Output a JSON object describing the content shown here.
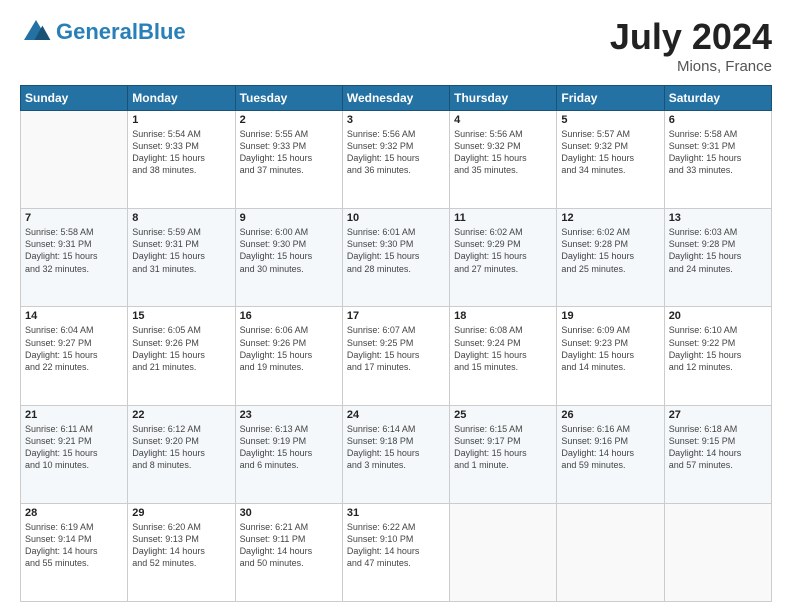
{
  "header": {
    "logo": {
      "text_general": "General",
      "text_blue": "Blue"
    },
    "title": "July 2024",
    "location": "Mions, France"
  },
  "days_of_week": [
    "Sunday",
    "Monday",
    "Tuesday",
    "Wednesday",
    "Thursday",
    "Friday",
    "Saturday"
  ],
  "weeks": [
    [
      {
        "day": "",
        "info": ""
      },
      {
        "day": "1",
        "info": "Sunrise: 5:54 AM\nSunset: 9:33 PM\nDaylight: 15 hours\nand 38 minutes."
      },
      {
        "day": "2",
        "info": "Sunrise: 5:55 AM\nSunset: 9:33 PM\nDaylight: 15 hours\nand 37 minutes."
      },
      {
        "day": "3",
        "info": "Sunrise: 5:56 AM\nSunset: 9:32 PM\nDaylight: 15 hours\nand 36 minutes."
      },
      {
        "day": "4",
        "info": "Sunrise: 5:56 AM\nSunset: 9:32 PM\nDaylight: 15 hours\nand 35 minutes."
      },
      {
        "day": "5",
        "info": "Sunrise: 5:57 AM\nSunset: 9:32 PM\nDaylight: 15 hours\nand 34 minutes."
      },
      {
        "day": "6",
        "info": "Sunrise: 5:58 AM\nSunset: 9:31 PM\nDaylight: 15 hours\nand 33 minutes."
      }
    ],
    [
      {
        "day": "7",
        "info": "Sunrise: 5:58 AM\nSunset: 9:31 PM\nDaylight: 15 hours\nand 32 minutes."
      },
      {
        "day": "8",
        "info": "Sunrise: 5:59 AM\nSunset: 9:31 PM\nDaylight: 15 hours\nand 31 minutes."
      },
      {
        "day": "9",
        "info": "Sunrise: 6:00 AM\nSunset: 9:30 PM\nDaylight: 15 hours\nand 30 minutes."
      },
      {
        "day": "10",
        "info": "Sunrise: 6:01 AM\nSunset: 9:30 PM\nDaylight: 15 hours\nand 28 minutes."
      },
      {
        "day": "11",
        "info": "Sunrise: 6:02 AM\nSunset: 9:29 PM\nDaylight: 15 hours\nand 27 minutes."
      },
      {
        "day": "12",
        "info": "Sunrise: 6:02 AM\nSunset: 9:28 PM\nDaylight: 15 hours\nand 25 minutes."
      },
      {
        "day": "13",
        "info": "Sunrise: 6:03 AM\nSunset: 9:28 PM\nDaylight: 15 hours\nand 24 minutes."
      }
    ],
    [
      {
        "day": "14",
        "info": "Sunrise: 6:04 AM\nSunset: 9:27 PM\nDaylight: 15 hours\nand 22 minutes."
      },
      {
        "day": "15",
        "info": "Sunrise: 6:05 AM\nSunset: 9:26 PM\nDaylight: 15 hours\nand 21 minutes."
      },
      {
        "day": "16",
        "info": "Sunrise: 6:06 AM\nSunset: 9:26 PM\nDaylight: 15 hours\nand 19 minutes."
      },
      {
        "day": "17",
        "info": "Sunrise: 6:07 AM\nSunset: 9:25 PM\nDaylight: 15 hours\nand 17 minutes."
      },
      {
        "day": "18",
        "info": "Sunrise: 6:08 AM\nSunset: 9:24 PM\nDaylight: 15 hours\nand 15 minutes."
      },
      {
        "day": "19",
        "info": "Sunrise: 6:09 AM\nSunset: 9:23 PM\nDaylight: 15 hours\nand 14 minutes."
      },
      {
        "day": "20",
        "info": "Sunrise: 6:10 AM\nSunset: 9:22 PM\nDaylight: 15 hours\nand 12 minutes."
      }
    ],
    [
      {
        "day": "21",
        "info": "Sunrise: 6:11 AM\nSunset: 9:21 PM\nDaylight: 15 hours\nand 10 minutes."
      },
      {
        "day": "22",
        "info": "Sunrise: 6:12 AM\nSunset: 9:20 PM\nDaylight: 15 hours\nand 8 minutes."
      },
      {
        "day": "23",
        "info": "Sunrise: 6:13 AM\nSunset: 9:19 PM\nDaylight: 15 hours\nand 6 minutes."
      },
      {
        "day": "24",
        "info": "Sunrise: 6:14 AM\nSunset: 9:18 PM\nDaylight: 15 hours\nand 3 minutes."
      },
      {
        "day": "25",
        "info": "Sunrise: 6:15 AM\nSunset: 9:17 PM\nDaylight: 15 hours\nand 1 minute."
      },
      {
        "day": "26",
        "info": "Sunrise: 6:16 AM\nSunset: 9:16 PM\nDaylight: 14 hours\nand 59 minutes."
      },
      {
        "day": "27",
        "info": "Sunrise: 6:18 AM\nSunset: 9:15 PM\nDaylight: 14 hours\nand 57 minutes."
      }
    ],
    [
      {
        "day": "28",
        "info": "Sunrise: 6:19 AM\nSunset: 9:14 PM\nDaylight: 14 hours\nand 55 minutes."
      },
      {
        "day": "29",
        "info": "Sunrise: 6:20 AM\nSunset: 9:13 PM\nDaylight: 14 hours\nand 52 minutes."
      },
      {
        "day": "30",
        "info": "Sunrise: 6:21 AM\nSunset: 9:11 PM\nDaylight: 14 hours\nand 50 minutes."
      },
      {
        "day": "31",
        "info": "Sunrise: 6:22 AM\nSunset: 9:10 PM\nDaylight: 14 hours\nand 47 minutes."
      },
      {
        "day": "",
        "info": ""
      },
      {
        "day": "",
        "info": ""
      },
      {
        "day": "",
        "info": ""
      }
    ]
  ]
}
